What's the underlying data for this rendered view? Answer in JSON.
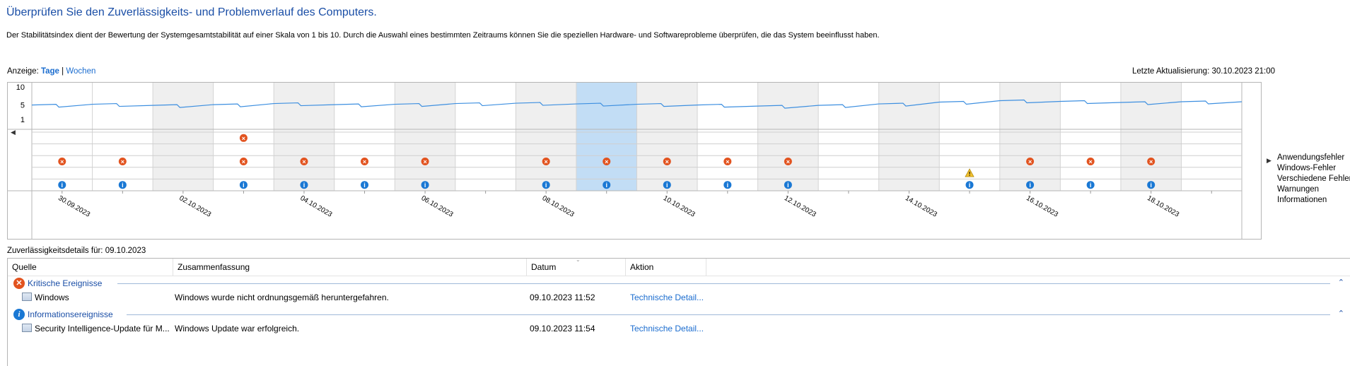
{
  "header": {
    "title": "Überprüfen Sie den Zuverlässigkeits- und Problemverlauf des Computers.",
    "description": "Der Stabilitätsindex dient der Bewertung der Systemgesamtstabilität auf einer Skala von 1 bis 10. Durch die Auswahl eines bestimmten Zeitraums können Sie die speziellen Hardware- und Softwareprobleme überprüfen, die das System beeinflusst haben."
  },
  "view": {
    "label": "Anzeige:",
    "days": "Tage",
    "separator": "|",
    "weeks": "Wochen"
  },
  "last_update": "Letzte Aktualisierung: 30.10.2023 21:00",
  "chart": {
    "y_ticks": [
      "10",
      "5",
      "1"
    ],
    "dates": [
      "30.09.2023",
      "02.10.2023",
      "04.10.2023",
      "06.10.2023",
      "08.10.2023",
      "10.10.2023",
      "12.10.2023",
      "14.10.2023",
      "16.10.2023",
      "18.10.2023"
    ],
    "legend": [
      "Anwendungsfehler",
      "Windows-Fehler",
      "Verschiedene Fehler",
      "Warnungen",
      "Informationen"
    ],
    "colors": {
      "line": "#3d8fe0",
      "selected": "#c2ddf5",
      "shade": "#efefef",
      "error": "#e2531f",
      "info": "#1a78d4",
      "warning": "#f2c12e"
    },
    "selected_column": 9
  },
  "chart_data": {
    "type": "line",
    "title": "",
    "ylim": [
      1,
      10
    ],
    "y_ticks": [
      10,
      5,
      1
    ],
    "columns": 20,
    "stability_index": [
      4.6,
      4.8,
      4.5,
      4.7,
      5.0,
      4.7,
      4.8,
      5.0,
      5.1,
      4.9,
      4.8,
      4.6,
      4.3,
      4.5,
      4.9,
      5.4,
      5.8,
      5.6,
      5.3,
      5.5
    ],
    "events": {
      "application_errors": [
        3
      ],
      "misc_errors": [
        0,
        1,
        3,
        4,
        5,
        6,
        8,
        9,
        10,
        11,
        12,
        16,
        17,
        18
      ],
      "warnings": [
        15
      ],
      "information": [
        0,
        1,
        3,
        4,
        5,
        6,
        8,
        9,
        10,
        11,
        12,
        15,
        16,
        17,
        18
      ]
    }
  },
  "details": {
    "label": "Zuverlässigkeitsdetails für: 09.10.2023",
    "columns": [
      "Quelle",
      "Zusammenfassung",
      "Datum",
      "Aktion"
    ],
    "groups": [
      {
        "title": "Kritische Ereignisse",
        "icon": "error-icon",
        "rows": [
          {
            "source": "Windows",
            "summary": "Windows wurde nicht ordnungsgemäß heruntergefahren.",
            "date": "09.10.2023 11:52",
            "action": "Technische Detail..."
          }
        ]
      },
      {
        "title": "Informationsereignisse",
        "icon": "info-icon",
        "rows": [
          {
            "source": "Security Intelligence-Update für M...",
            "summary": "Windows Update war erfolgreich.",
            "date": "09.10.2023 11:54",
            "action": "Technische Detail..."
          }
        ]
      }
    ]
  }
}
